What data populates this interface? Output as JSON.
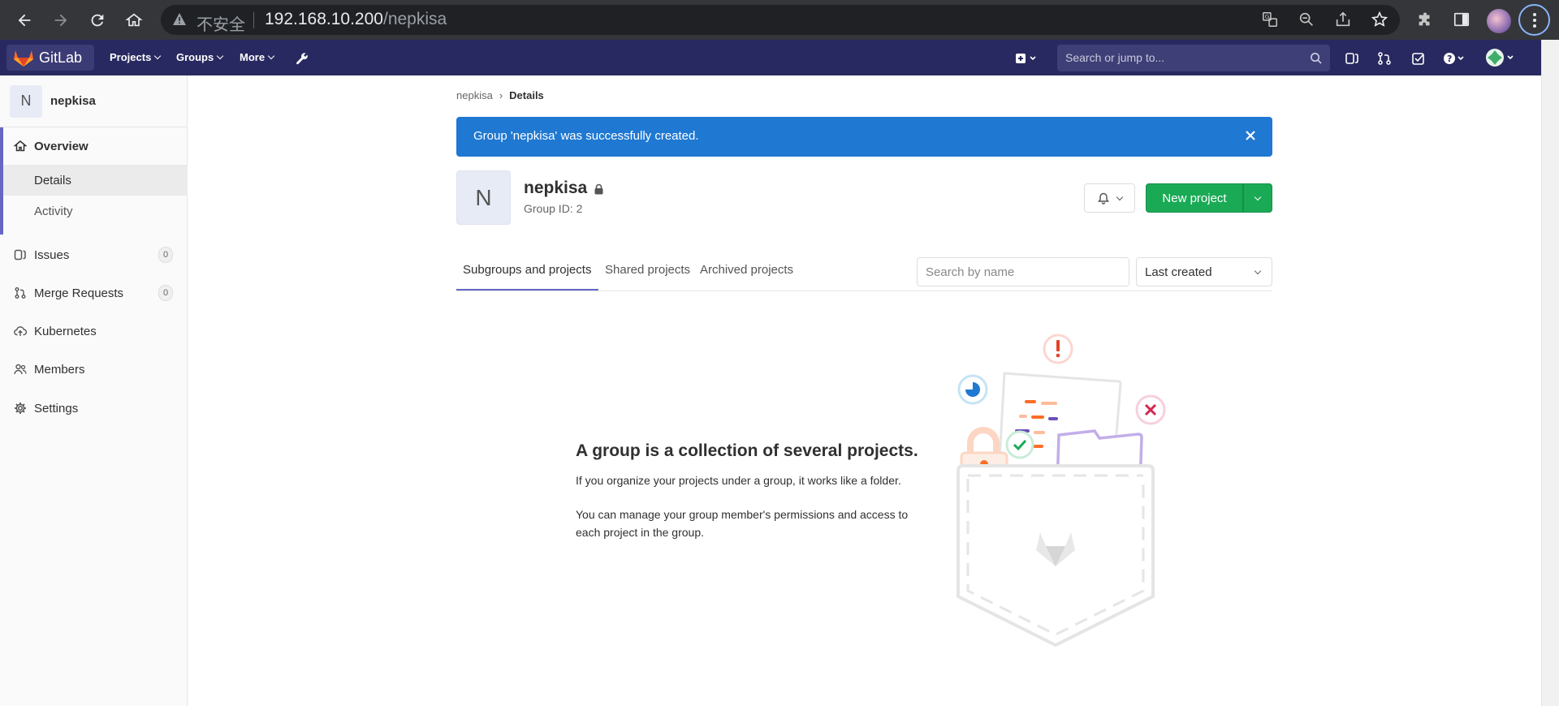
{
  "browser": {
    "insecure_label": "不安全",
    "url_host": "192.168.10.200",
    "url_path": "/nepkisa"
  },
  "header": {
    "app_name": "GitLab",
    "menu": [
      "Projects",
      "Groups",
      "More"
    ],
    "search_placeholder": "Search or jump to..."
  },
  "sidebar": {
    "avatar_letter": "N",
    "group_name": "nepkisa",
    "items": [
      {
        "label": "Overview"
      },
      {
        "label": "Details"
      },
      {
        "label": "Activity"
      },
      {
        "label": "Issues",
        "count": "0"
      },
      {
        "label": "Merge Requests",
        "count": "0"
      },
      {
        "label": "Kubernetes"
      },
      {
        "label": "Members"
      },
      {
        "label": "Settings"
      }
    ]
  },
  "breadcrumb": {
    "group": "nepkisa",
    "current": "Details"
  },
  "flash": {
    "message": "Group 'nepkisa' was successfully created."
  },
  "group": {
    "avatar_letter": "N",
    "name": "nepkisa",
    "id_text": "Group ID: 2"
  },
  "actions": {
    "new_project": "New project"
  },
  "tabs": [
    "Subgroups and projects",
    "Shared projects",
    "Archived projects"
  ],
  "filters": {
    "search_placeholder": "Search by name",
    "sort_selected": "Last created"
  },
  "empty_state": {
    "title": "A group is a collection of several projects.",
    "line1": "If you organize your projects under a group, it works like a folder.",
    "line2": "You can manage your group member's permissions and access to each project in the group."
  },
  "colors": {
    "header_bg": "#292961",
    "accent": "#6666c4",
    "flash_bg": "#1f78d1",
    "success": "#1aaa55"
  }
}
